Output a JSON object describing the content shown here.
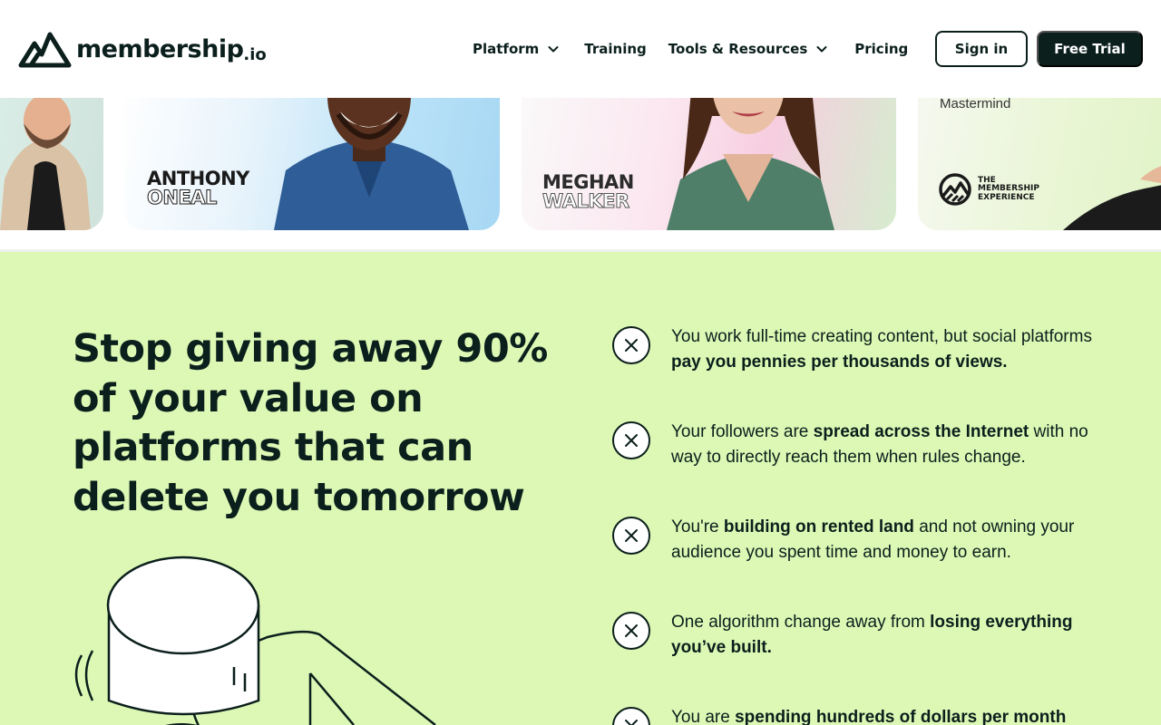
{
  "header": {
    "logo": {
      "word": "membership",
      "tld": ".io"
    },
    "nav": [
      {
        "label": "Platform",
        "has_dropdown": true
      },
      {
        "label": "Training",
        "has_dropdown": false
      },
      {
        "label": "Tools & Resources",
        "has_dropdown": true
      },
      {
        "label": "Pricing",
        "has_dropdown": false
      }
    ],
    "sign_in_label": "Sign in",
    "free_trial_label": "Free Trial"
  },
  "cards": {
    "anthony": {
      "line1": "ANTHONY",
      "line2": "ONEAL"
    },
    "meghan": {
      "line1": "MEGHAN",
      "line2": "WALKER"
    },
    "experience": {
      "subtitle": "Mastermind",
      "logo_line1": "THE",
      "logo_line2": "MEMBERSHIP",
      "logo_line3": "EXPERIENCE"
    }
  },
  "section": {
    "headline": "Stop giving away 90% of your value on platforms that can delete you tomorrow",
    "pain_points": [
      {
        "before": "You work full-time creating content, but social platforms ",
        "bold": "pay you pennies per thousands of views.",
        "after": ""
      },
      {
        "before": "Your followers are ",
        "bold": "spread across the Internet",
        "after": " with no way to directly reach them when rules change."
      },
      {
        "before": "You're ",
        "bold": "building on rented land",
        "after": " and not owning your audience you spent time and money to earn."
      },
      {
        "before": "One algorithm change away from ",
        "bold": "losing everything you’ve built.",
        "after": ""
      },
      {
        "before": "You are ",
        "bold": "spending hundreds of dollars per month",
        "after": ""
      }
    ]
  },
  "colors": {
    "brand_dark": "#0b1f1c",
    "section_bg": "#ddf8b5",
    "white": "#ffffff"
  },
  "icons": [
    "logo-mountain-icon",
    "chevron-down-icon",
    "x-circle-icon",
    "membership-experience-logo-icon"
  ]
}
